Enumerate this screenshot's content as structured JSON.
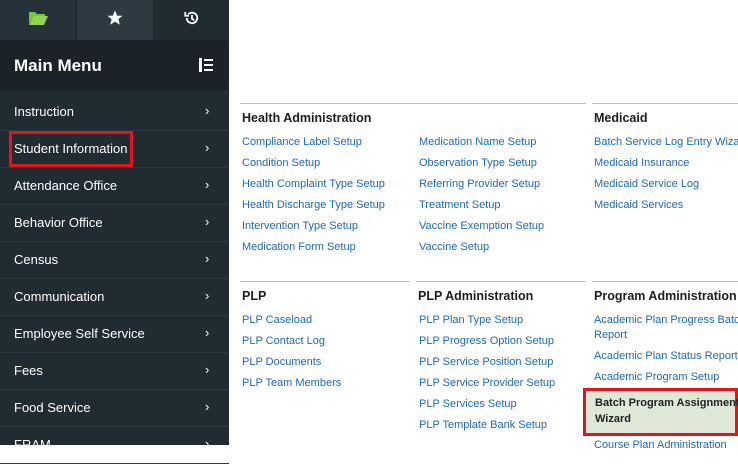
{
  "sidebar": {
    "menu_title": "Main Menu",
    "items": [
      {
        "label": "Instruction"
      },
      {
        "label": "Student Information"
      },
      {
        "label": "Attendance Office"
      },
      {
        "label": "Behavior Office"
      },
      {
        "label": "Census"
      },
      {
        "label": "Communication"
      },
      {
        "label": "Employee Self Service"
      },
      {
        "label": "Fees"
      },
      {
        "label": "Food Service"
      },
      {
        "label": "FRAM"
      }
    ],
    "chevron": "›"
  },
  "sections": {
    "health": {
      "title": "Health Administration",
      "col1": [
        "Compliance Label Setup",
        "Condition Setup",
        "Health Complaint Type Setup",
        "Health Discharge Type Setup",
        "Intervention Type Setup",
        "Medication Form Setup"
      ],
      "col2": [
        "Medication Name Setup",
        "Observation Type Setup",
        "Referring Provider Setup",
        "Treatment Setup",
        "Vaccine Exemption Setup",
        "Vaccine Setup"
      ]
    },
    "medicaid": {
      "title": "Medicaid",
      "links": [
        "Batch Service Log Entry Wizard",
        "Medicaid Insurance",
        "Medicaid Service Log",
        "Medicaid Services"
      ]
    },
    "plp": {
      "title": "PLP",
      "links": [
        "PLP Caseload",
        "PLP Contact Log",
        "PLP Documents",
        "PLP Team Members"
      ]
    },
    "plp_admin": {
      "title": "PLP Administration",
      "links": [
        "PLP Plan Type Setup",
        "PLP Progress Option Setup",
        "PLP Service Position Setup",
        "PLP Service Provider Setup",
        "PLP Services Setup",
        "PLP Template Bank Setup"
      ]
    },
    "program_admin": {
      "title": "Program Administration",
      "link1_line1": "Academic Plan Progress Batch",
      "link1_line2": "Report",
      "link2": "Academic Plan Status Report",
      "link3": "Academic Program Setup",
      "selected_line1": "Batch Program Assignment",
      "selected_line2": "Wizard",
      "link5": "Course Plan Administration"
    }
  }
}
